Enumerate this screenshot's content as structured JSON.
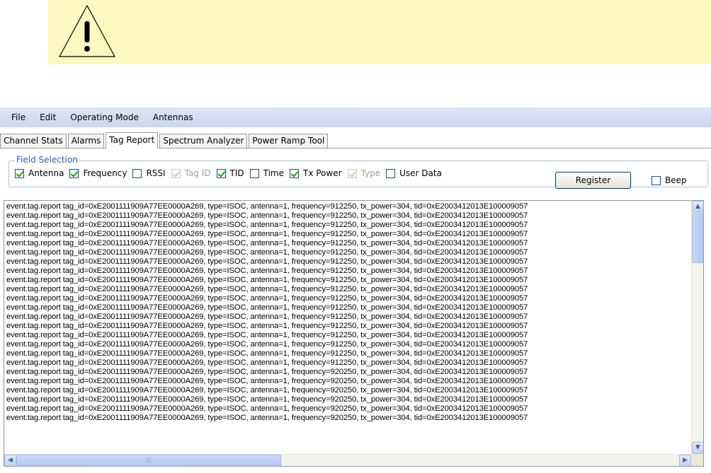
{
  "menu": [
    "File",
    "Edit",
    "Operating Mode",
    "Antennas"
  ],
  "tabs": [
    {
      "label": "Channel Stats",
      "active": false
    },
    {
      "label": "Alarms",
      "active": false
    },
    {
      "label": "Tag Report",
      "active": true
    },
    {
      "label": "Spectrum Analyzer",
      "active": false
    },
    {
      "label": "Power Ramp Tool",
      "active": false
    }
  ],
  "field_selection": {
    "legend": "Field Selection",
    "options": [
      {
        "label": "Antenna",
        "checked": true,
        "enabled": true
      },
      {
        "label": "Frequency",
        "checked": true,
        "enabled": true
      },
      {
        "label": "RSSI",
        "checked": false,
        "enabled": true
      },
      {
        "label": "Tag ID",
        "checked": true,
        "enabled": false
      },
      {
        "label": "TID",
        "checked": true,
        "enabled": true
      },
      {
        "label": "Time",
        "checked": false,
        "enabled": true
      },
      {
        "label": "Tx Power",
        "checked": true,
        "enabled": true
      },
      {
        "label": "Type",
        "checked": true,
        "enabled": false
      },
      {
        "label": "User Data",
        "checked": false,
        "enabled": true
      }
    ]
  },
  "register_label": "Register",
  "beep": {
    "label": "Beep",
    "checked": false
  },
  "log_lines": [
    "event.tag.report tag_id=0xE2001111909A77EE0000A269, type=ISOC, antenna=1, frequency=912250, tx_power=304, tid=0xE2003412013E100009057",
    "event.tag.report tag_id=0xE2001111909A77EE0000A269, type=ISOC, antenna=1, frequency=912250, tx_power=304, tid=0xE2003412013E100009057",
    "event.tag.report tag_id=0xE2001111909A77EE0000A269, type=ISOC, antenna=1, frequency=912250, tx_power=304, tid=0xE2003412013E100009057",
    "event.tag.report tag_id=0xE2001111909A77EE0000A269, type=ISOC, antenna=1, frequency=912250, tx_power=304, tid=0xE2003412013E100009057",
    "event.tag.report tag_id=0xE2001111909A77EE0000A269, type=ISOC, antenna=1, frequency=912250, tx_power=304, tid=0xE2003412013E100009057",
    "event.tag.report tag_id=0xE2001111909A77EE0000A269, type=ISOC, antenna=1, frequency=912250, tx_power=304, tid=0xE2003412013E100009057",
    "event.tag.report tag_id=0xE2001111909A77EE0000A269, type=ISOC, antenna=1, frequency=912250, tx_power=304, tid=0xE2003412013E100009057",
    "event.tag.report tag_id=0xE2001111909A77EE0000A269, type=ISOC, antenna=1, frequency=912250, tx_power=304, tid=0xE2003412013E100009057",
    "event.tag.report tag_id=0xE2001111909A77EE0000A269, type=ISOC, antenna=1, frequency=912250, tx_power=304, tid=0xE2003412013E100009057",
    "event.tag.report tag_id=0xE2001111909A77EE0000A269, type=ISOC, antenna=1, frequency=912250, tx_power=304, tid=0xE2003412013E100009057",
    "event.tag.report tag_id=0xE2001111909A77EE0000A269, type=ISOC, antenna=1, frequency=912250, tx_power=304, tid=0xE2003412013E100009057",
    "event.tag.report tag_id=0xE2001111909A77EE0000A269, type=ISOC, antenna=1, frequency=912250, tx_power=304, tid=0xE2003412013E100009057",
    "event.tag.report tag_id=0xE2001111909A77EE0000A269, type=ISOC, antenna=1, frequency=912250, tx_power=304, tid=0xE2003412013E100009057",
    "event.tag.report tag_id=0xE2001111909A77EE0000A269, type=ISOC, antenna=1, frequency=912250, tx_power=304, tid=0xE2003412013E100009057",
    "event.tag.report tag_id=0xE2001111909A77EE0000A269, type=ISOC, antenna=1, frequency=912250, tx_power=304, tid=0xE2003412013E100009057",
    "event.tag.report tag_id=0xE2001111909A77EE0000A269, type=ISOC, antenna=1, frequency=912250, tx_power=304, tid=0xE2003412013E100009057",
    "event.tag.report tag_id=0xE2001111909A77EE0000A269, type=ISOC, antenna=1, frequency=912250, tx_power=304, tid=0xE2003412013E100009057",
    "event.tag.report tag_id=0xE2001111909A77EE0000A269, type=ISOC, antenna=1, frequency=912250, tx_power=304, tid=0xE2003412013E100009057",
    "event.tag.report tag_id=0xE2001111909A77EE0000A269, type=ISOC, antenna=1, frequency=920250, tx_power=304, tid=0xE2003412013E100009057",
    "event.tag.report tag_id=0xE2001111909A77EE0000A269, type=ISOC, antenna=1, frequency=920250, tx_power=304, tid=0xE2003412013E100009057",
    "event.tag.report tag_id=0xE2001111909A77EE0000A269, type=ISOC, antenna=1, frequency=920250, tx_power=304, tid=0xE2003412013E100009057",
    "event.tag.report tag_id=0xE2001111909A77EE0000A269, type=ISOC, antenna=1, frequency=920250, tx_power=304, tid=0xE2003412013E100009057",
    "event.tag.report tag_id=0xE2001111909A77EE0000A269, type=ISOC, antenna=1, frequency=920250, tx_power=304, tid=0xE2003412013E100009057",
    "event.tag.report tag_id=0xE2001111909A77EE0000A269, type=ISOC, antenna=1, frequency=920250, tx_power=304, tid=0xE2003412013E100009057"
  ],
  "icons": {
    "warning": "warning-triangle-icon",
    "scroll_up": "scroll-up-arrow-icon",
    "scroll_down": "scroll-down-arrow-icon",
    "scroll_left": "scroll-left-arrow-icon",
    "scroll_right": "scroll-right-arrow-icon"
  },
  "colors": {
    "banner": "#fef8c0",
    "menubar": "#c9d7ef",
    "legend": "#2a5bd7",
    "checkmark": "#21a121"
  }
}
